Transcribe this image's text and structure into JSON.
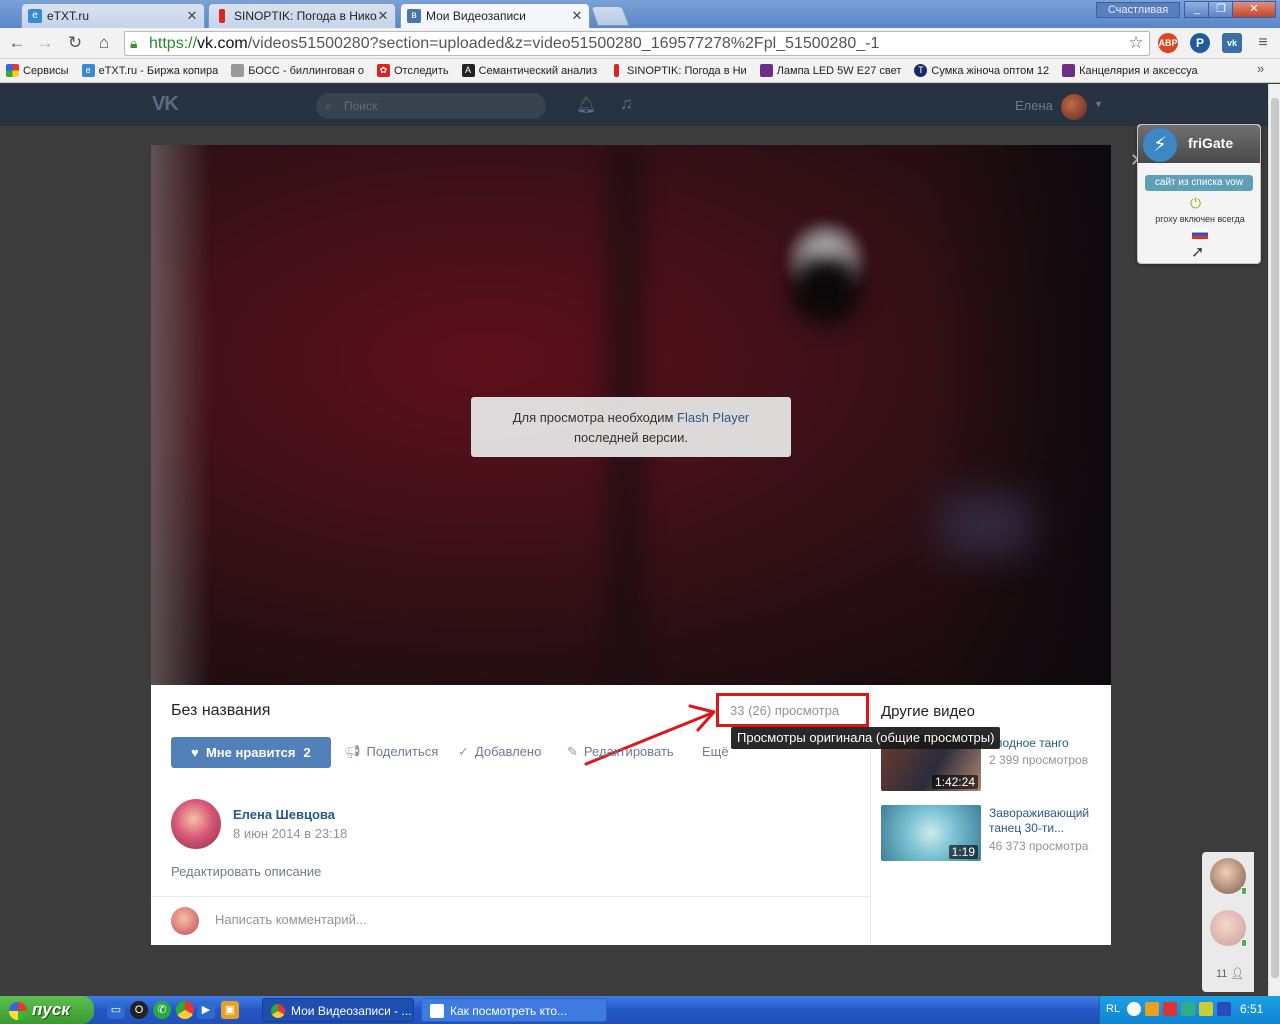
{
  "browser": {
    "tabs": [
      {
        "label": "eTXT.ru",
        "icon": "etxt-favicon",
        "active": false
      },
      {
        "label": "SINOPTIK: Погода в Никола",
        "icon": "thermometer-favicon",
        "active": false
      },
      {
        "label": "Мои Видеозаписи",
        "icon": "vk-favicon",
        "active": true
      }
    ],
    "window_user": "Счастливая",
    "url": {
      "scheme": "https://",
      "host": "vk.com",
      "path": "/videos51500280?section=uploaded&z=video51500280_169577278%2Fpl_51500280_-1"
    },
    "extensions": [
      "ABP",
      "P",
      "vk"
    ],
    "bookmarks": [
      {
        "label": "Сервисы",
        "icon": "apps-icon"
      },
      {
        "label": "eTXT.ru - Биржа копира",
        "icon": "etxt-icon"
      },
      {
        "label": "БОСС - биллинговая о",
        "icon": "boss-icon"
      },
      {
        "label": "Отследить",
        "icon": "track-icon"
      },
      {
        "label": "Семантический анализ",
        "icon": "a-icon"
      },
      {
        "label": "SINOPTIK: Погода в Ни",
        "icon": "thermometer-icon"
      },
      {
        "label": "Лампа LED 5W E27 свет",
        "icon": "square-icon"
      },
      {
        "label": "Сумка жіноча оптом 12",
        "icon": "t-icon"
      },
      {
        "label": "Канцелярия и аксессуа",
        "icon": "square-icon"
      }
    ],
    "bookmarks_more": "»"
  },
  "vk": {
    "logo": "VK",
    "search_placeholder": "Поиск",
    "user_name": "Елена"
  },
  "video": {
    "flash_text_1": "Для просмотра необходим ",
    "flash_link": "Flash Player",
    "flash_text_2": "последней версии.",
    "title": "Без названия",
    "views": "33 (26) просмотра",
    "tooltip": "Просмотры оригинала (общие просмотры)",
    "like_label": "Мне нравится",
    "like_count": "2",
    "actions": {
      "share": "Поделиться",
      "added": "Добавлено",
      "edit": "Редактировать",
      "more": "Ещё"
    },
    "author_name": "Елена Шевцова",
    "author_date": "8 июн 2014 в 23:18",
    "edit_description": "Редактировать описание",
    "comment_placeholder": "Написать комментарий..."
  },
  "other_videos": {
    "title": "Другие видео",
    "items": [
      {
        "title": "олодное танго",
        "views": "2 399 просмотров",
        "duration": "1:42:24"
      },
      {
        "title": "Завораживающий танец 30-ти...",
        "views": "46 373 просмотра",
        "duration": "1:19"
      }
    ]
  },
  "frigate": {
    "name": "friGate",
    "badge": "сайт из списка vow",
    "proxy": "proxy включен всегда"
  },
  "friends": {
    "count": "11"
  },
  "taskbar": {
    "start": "пуск",
    "tasks": [
      {
        "label": "Мои Видеозаписи - ...",
        "active": true
      },
      {
        "label": "Как посмотреть кто...",
        "active": false
      }
    ],
    "lang": "RL",
    "clock": "6:51"
  },
  "colors": {
    "vk_blue": "#5181b8",
    "vk_link": "#2a5885",
    "highlight_red": "#e0151c",
    "vk_header": "#283341"
  }
}
